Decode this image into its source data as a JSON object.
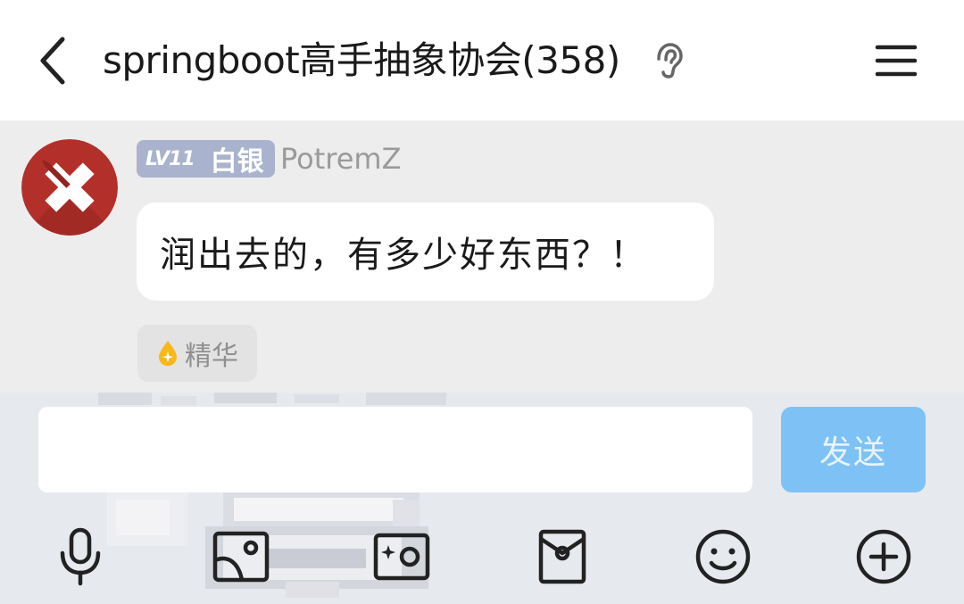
{
  "header": {
    "title": "springboot高手抽象协会(358)",
    "back_icon": "chevron-left-icon",
    "ear_icon": "ear-icon",
    "menu_icon": "hamburger-menu-icon"
  },
  "message": {
    "level": "LV11",
    "rank": "白银",
    "username": "PotremZ",
    "text": "润出去的，有多少好东西？！",
    "essence_label": "精华",
    "badge_color": "#a9b3cd"
  },
  "composer": {
    "input_value": "",
    "send_label": "发送",
    "send_color": "#7ec2f5"
  },
  "toolbar": {
    "icons": [
      "microphone-icon",
      "picture-icon",
      "camera-icon",
      "red-packet-icon",
      "emoji-icon",
      "plus-icon"
    ]
  }
}
